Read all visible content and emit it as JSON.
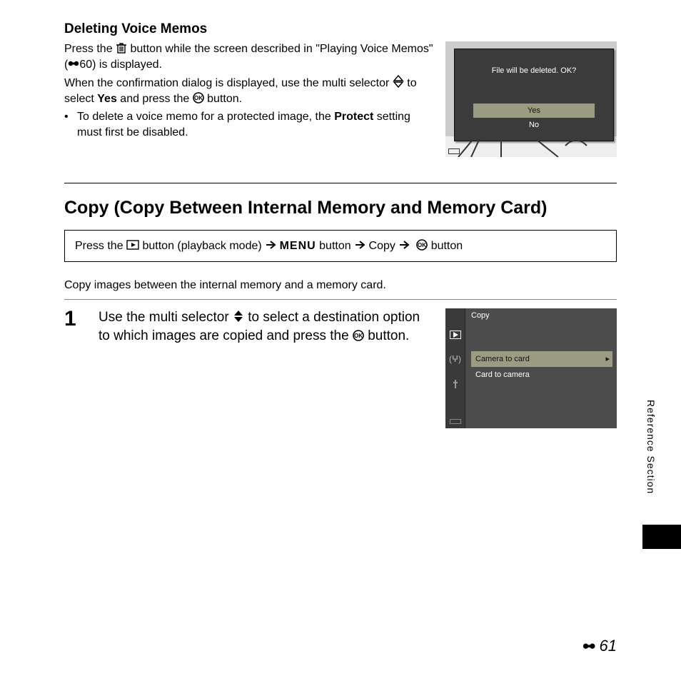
{
  "section1": {
    "heading": "Deleting Voice Memos",
    "p1a": "Press the ",
    "p1b": " button while the screen described in \"Playing Voice Memos\" (",
    "p1c": "60) is displayed.",
    "p2a": "When the confirmation dialog is displayed, use the multi selector ",
    "p2b": " to select ",
    "p2c": "Yes",
    "p2d": " and press the ",
    "p2e": " button.",
    "bullet_a": "To delete a voice memo for a protected image, the ",
    "bullet_b": "Protect",
    "bullet_c": " setting must first be disabled."
  },
  "screenshot1": {
    "message": "File will be deleted. OK?",
    "opt_yes": "Yes",
    "opt_no": "No"
  },
  "section2": {
    "heading": "Copy (Copy Between Internal Memory and Memory Card)",
    "nav_a": "Press the ",
    "nav_b": " button (playback mode) ",
    "nav_c": "MENU",
    "nav_d": " button ",
    "nav_e": " Copy ",
    "nav_f": " button",
    "desc": "Copy images between the internal memory and a memory card.",
    "step_num": "1",
    "step_a": "Use the multi selector ",
    "step_b": " to select a destination option to which images are copied and press the ",
    "step_c": " button."
  },
  "screenshot2": {
    "title": "Copy",
    "item1": "Camera to card",
    "item2": "Card to camera"
  },
  "side_label": "Reference Section",
  "page_number": "61"
}
